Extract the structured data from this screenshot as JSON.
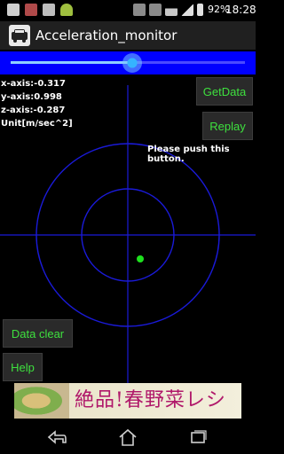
{
  "status_bar": {
    "battery_percent": "92%",
    "time": "18:28",
    "icons": [
      "notification-icon",
      "shield-icon",
      "gallery-icon",
      "android-icon",
      "nfc-icon",
      "mute-icon",
      "wifi-icon",
      "signal-icon",
      "battery-icon"
    ]
  },
  "app": {
    "title": "Acceleration_monitor"
  },
  "slider": {
    "value_fraction": 0.52,
    "colors": {
      "bar": "#0000ff",
      "thumb": "#35b4ff"
    }
  },
  "readout": {
    "x": "x-axis:-0.317",
    "y": "y-axis:0.998",
    "z": "z-axis:-0.287",
    "unit": "Unit[m/sec^2]"
  },
  "buttons": {
    "get_data": "GetData",
    "replay": "Replay",
    "data_clear": "Data clear",
    "help": "Help"
  },
  "hint": "Please push this button.",
  "plot": {
    "colors": {
      "lines": "#1a1ad8",
      "point": "#1ee01e"
    },
    "point": {
      "x": -0.317,
      "y": 0.998
    }
  },
  "ad": {
    "text": "絶品!春野菜レシピ"
  },
  "nav": {
    "icons": [
      "back-icon",
      "home-icon",
      "recent-apps-icon"
    ]
  }
}
